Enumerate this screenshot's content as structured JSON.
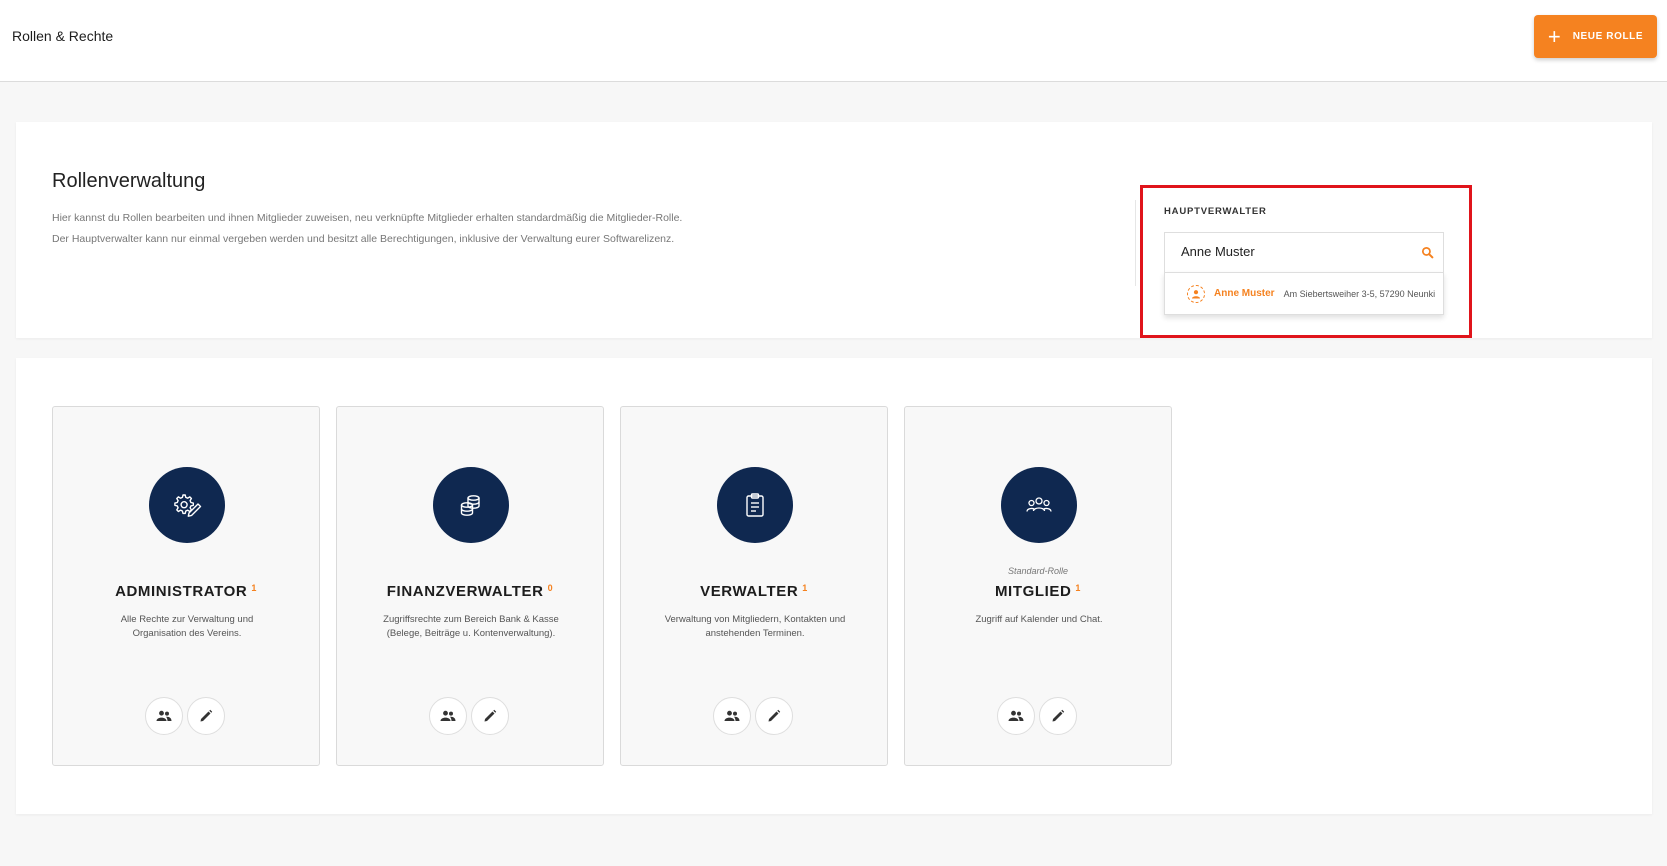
{
  "header": {
    "title": "Rollen & Rechte",
    "new_role_label": "NEUE ROLLE",
    "new_role_icon": "plus-icon"
  },
  "intro": {
    "heading": "Rollenverwaltung",
    "line1": "Hier kannst du Rollen bearbeiten und ihnen Mitglieder zuweisen, neu verknüpfte Mitglieder erhalten standardmäßig die Mitglieder-Rolle.",
    "line2": "Der Hauptverwalter kann nur einmal vergeben werden und besitzt alle Berechtigungen, inklusive der Verwaltung eurer Softwarelizenz."
  },
  "main_admin": {
    "label": "HAUPTVERWALTER",
    "input_value": "Anne Muster",
    "search_icon": "search-icon",
    "suggestion": {
      "name": "Anne Muster",
      "address": "Am Siebertsweiher 3-5, 57290 Neunki",
      "icon": "user-icon"
    }
  },
  "roles": [
    {
      "name": "ADMINISTRATOR",
      "count": "1",
      "description": "Alle Rechte zur Verwaltung und Organisation des Vereins.",
      "icon": "gear-pencil-icon",
      "standard_label": ""
    },
    {
      "name": "FINANZVERWALTER",
      "count": "0",
      "description": "Zugriffsrechte zum Bereich Bank & Kasse (Belege, Beiträge u. Kontenverwaltung).",
      "icon": "coins-icon",
      "standard_label": ""
    },
    {
      "name": "VERWALTER",
      "count": "1",
      "description": "Verwaltung von Mitgliedern, Kontakten und anstehenden Terminen.",
      "icon": "clipboard-icon",
      "standard_label": ""
    },
    {
      "name": "MITGLIED",
      "count": "1",
      "description": "Zugriff auf Kalender und Chat.",
      "icon": "group-icon",
      "standard_label": "Standard-Rolle"
    }
  ],
  "colors": {
    "accent": "#f58220",
    "navy": "#0f2850",
    "highlight": "#e0141b"
  }
}
